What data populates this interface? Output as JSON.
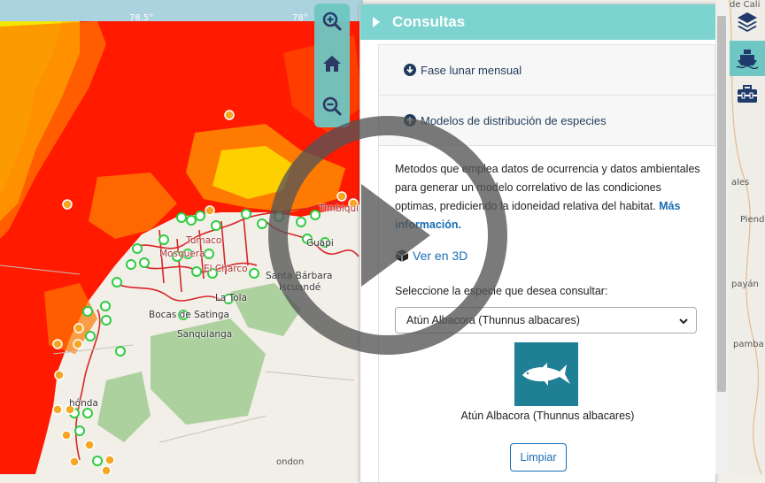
{
  "map": {
    "ticks": [
      "78.5°",
      "78°"
    ],
    "places": [
      "Santa Bárbara",
      "Iscuandé",
      "Bocas de Satinga",
      "Sanquianga",
      "La Tola",
      "Guapi",
      "Tumaco",
      "Mosquera",
      "El Charco",
      "Timbiquí"
    ],
    "edge_places": [
      "de Cali",
      "ales",
      "Piend",
      "payán",
      "pamba",
      "hónda",
      "ondon"
    ],
    "colors": {
      "heat_red": "#ff1a00",
      "heat_orange": "#ff7a00",
      "heat_yellow": "#ffe600",
      "heat_green": "#b5e61d",
      "station_green": "#2ecc40",
      "marker_orange": "#f5a623"
    }
  },
  "zoom": {
    "zoom_in_icon": "zoom-in-icon",
    "home_icon": "home-icon",
    "zoom_out_icon": "zoom-out-icon",
    "color": "#6ec7c3"
  },
  "panel": {
    "title": "Consultas",
    "sections": [
      {
        "label": "Fase lunar mensual",
        "icon": "arrow-down-circle-icon"
      },
      {
        "label": "Modelos de distribución de especies",
        "icon": "arrow-up-circle-icon"
      }
    ],
    "description": "Metodos que emplea datos de ocurrencia y datos ambientales para generar un modelo correlativo de las condiciones optimas, prediciendo la idoneidad relativa del habitat.",
    "more_info": "Más información.",
    "view_3d": "Ver en 3D",
    "select_label": "Seleccione la especie que desea consultar:",
    "selected_species": "Atún Albacora (Thunnus albacares)",
    "species_name": "Atún Albacora (Thunnus albacares)",
    "clear_button": "Limpiar"
  },
  "sidebar": {
    "icons": [
      "layers-icon",
      "ship-icon",
      "toolbox-icon"
    ]
  }
}
